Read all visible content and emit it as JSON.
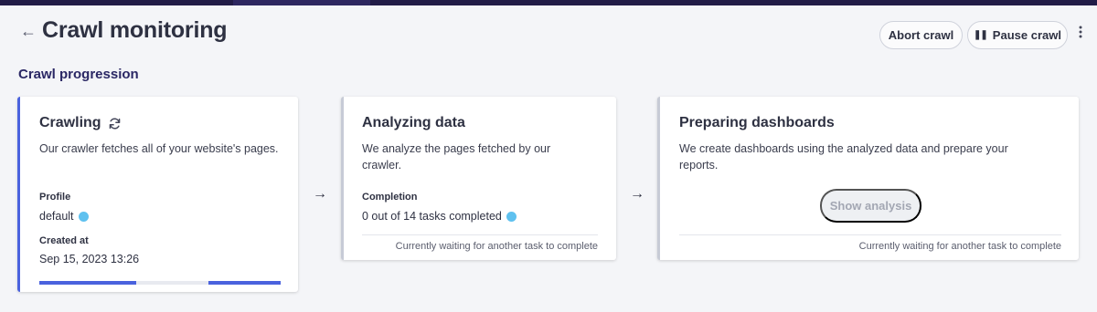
{
  "header": {
    "title": "Crawl monitoring",
    "abort_label": "Abort crawl",
    "pause_label": "Pause crawl"
  },
  "section": {
    "title": "Crawl progression"
  },
  "steps": [
    {
      "title": "Crawling",
      "description": "Our crawler fetches all of your website's pages.",
      "profile_label": "Profile",
      "profile_value": "default",
      "created_label": "Created at",
      "created_value": "Sep 15, 2023 13:26",
      "state": "active"
    },
    {
      "title": "Analyzing data",
      "description": "We analyze the pages fetched by our crawler.",
      "completion_label": "Completion",
      "completion_value": "0 out of 14 tasks completed",
      "status": "Currently waiting for another task to complete",
      "state": "pending"
    },
    {
      "title": "Preparing dashboards",
      "description": "We create dashboards using the analyzed data and prepare your reports.",
      "button_label": "Show analysis",
      "status": "Currently waiting for another task to complete",
      "state": "pending"
    }
  ],
  "icons": {
    "back": "arrow-left-icon",
    "refresh": "refresh-icon",
    "info": "info-icon",
    "pause": "pause-icon",
    "more": "more-vertical-icon",
    "arrow_right": "arrow-right-icon"
  },
  "colors": {
    "accent": "#4a62de",
    "topbar": "#221c47",
    "section_title": "#2b2865",
    "info_dot": "#5fc1ef",
    "pending_border": "#c7cbd6"
  }
}
